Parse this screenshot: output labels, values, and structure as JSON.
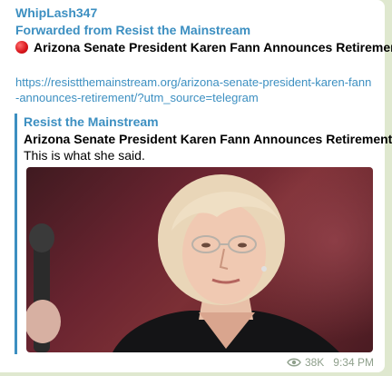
{
  "message": {
    "sender": "WhipLash347",
    "forwarded_from": "Forwarded from Resist the Mainstream",
    "headline_icon": "red-circle-icon",
    "headline": "Arizona Senate President Karen Fann Announces Retirement",
    "link": "https://resistthemainstream.org/arizona-senate-president-karen-fann-announces-retirement/?utm_source=telegram",
    "preview": {
      "site_name": "Resist the Mainstream",
      "title": "Arizona Senate President Karen Fann Announces Retirement",
      "description": "This is what she said.",
      "image_icon": "photo-woman-microphone"
    },
    "views_icon": "eye-icon",
    "views": "38K",
    "time": "9:34 PM"
  },
  "colors": {
    "accent": "#3c8fc1",
    "background": "#dfe8cf",
    "bubble": "#ffffff",
    "meta": "#8fa08c"
  }
}
